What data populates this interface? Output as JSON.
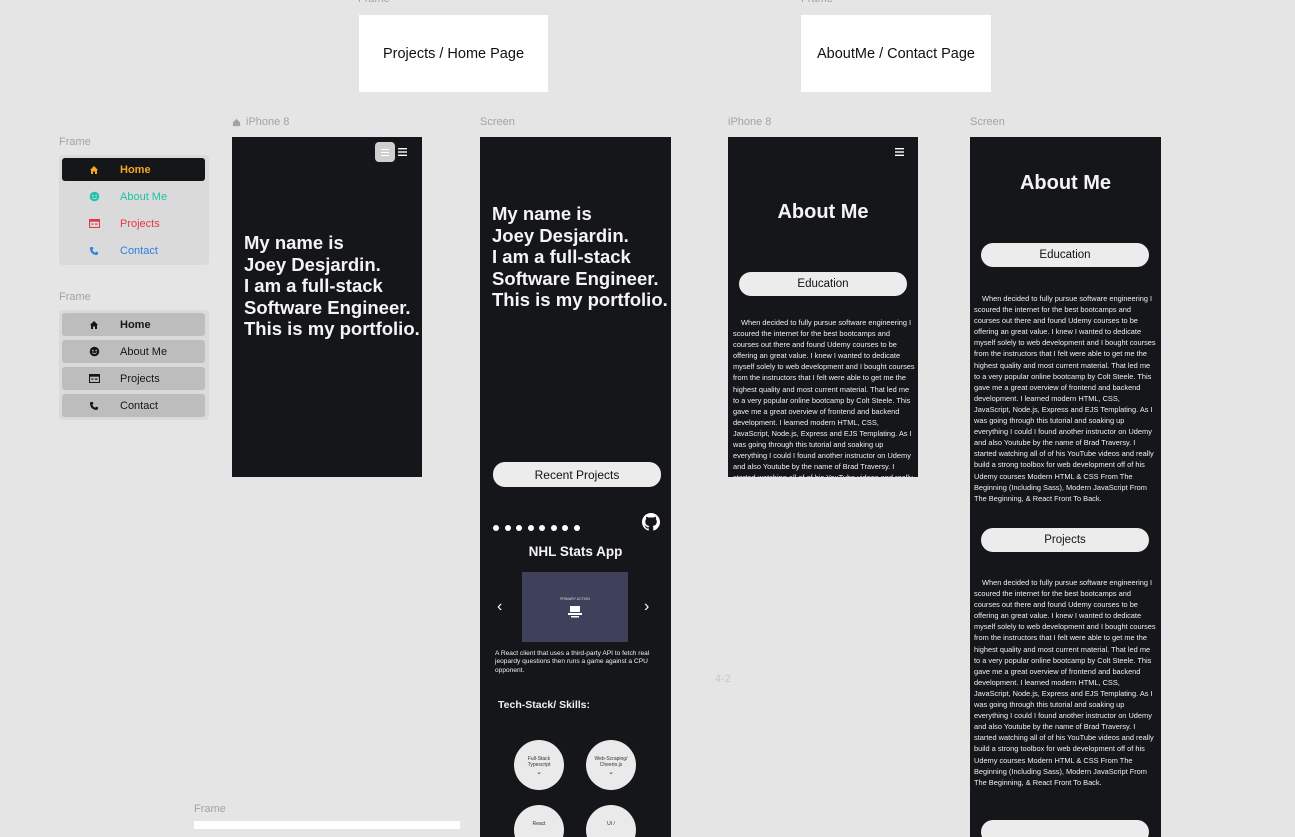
{
  "canvas": {
    "frame_label": "Frame",
    "iphone_label": "iPhone 8",
    "screen_label": "Screen",
    "stray_label": "4-2"
  },
  "cards": {
    "projects_home": "Projects / Home Page",
    "aboutme_contact": "AboutMe / Contact Page"
  },
  "menus": {
    "items": [
      "Home",
      "About Me",
      "Projects",
      "Contact"
    ],
    "colors": {
      "home": "#f5a623",
      "about": "#21c2a8",
      "projects": "#e5364a",
      "contact": "#2f7fe0",
      "dark_row": "#151619",
      "light_row": "#bdbdbd"
    }
  },
  "hero": {
    "text": "My name is\nJoey Desjardin.\nI am a full-stack\nSoftware Engineer.\nThis is my portfolio."
  },
  "projects_screen": {
    "recent_projects": "Recent Projects",
    "project_title": "NHL Stats App",
    "project_description": "A React client that uses a third-party API to fetch real jeopardy questions then runs a game against a CPU opponent.",
    "tech_stack": "Tech-Stack/ Skills:",
    "skills": [
      "Full-Stack Typescript",
      "Web-Scraping/ Cheerio.js",
      "React",
      "UI /"
    ],
    "dots_count": 8,
    "preview_caption": "PRIMARY ACTION",
    "prev_arrow": "‹",
    "next_arrow": "›",
    "github_icon": "github-icon"
  },
  "about": {
    "title": "About Me",
    "education": "Education",
    "projects": "Projects",
    "paragraph": "When decided to fully pursue software engineering I scoured the internet for the best bootcamps and courses out there and found Udemy courses to be offering an great value. I knew I wanted to dedicate myself solely to web development and I bought courses from the instructors that I felt were able to get me the highest quality and most current material. That led me to a very popular online bootcamp by Colt Steele. This gave me a great overview of frontend and backend development. I learned modern HTML, CSS, JavaScript, Node.js, Express and EJS Templating. As I was going through this tutorial and soaking up everything I could I found another instructor on Udemy and also Youtube by the name of Brad Traversy. I started watching all of of his YouTube videos and really build a strong toolbox for web development off of his Udemy courses Modern HTML & CSS From The Beginning (Including Sass), Modern JavaScript From The Beginning, & React Front To Back."
  }
}
